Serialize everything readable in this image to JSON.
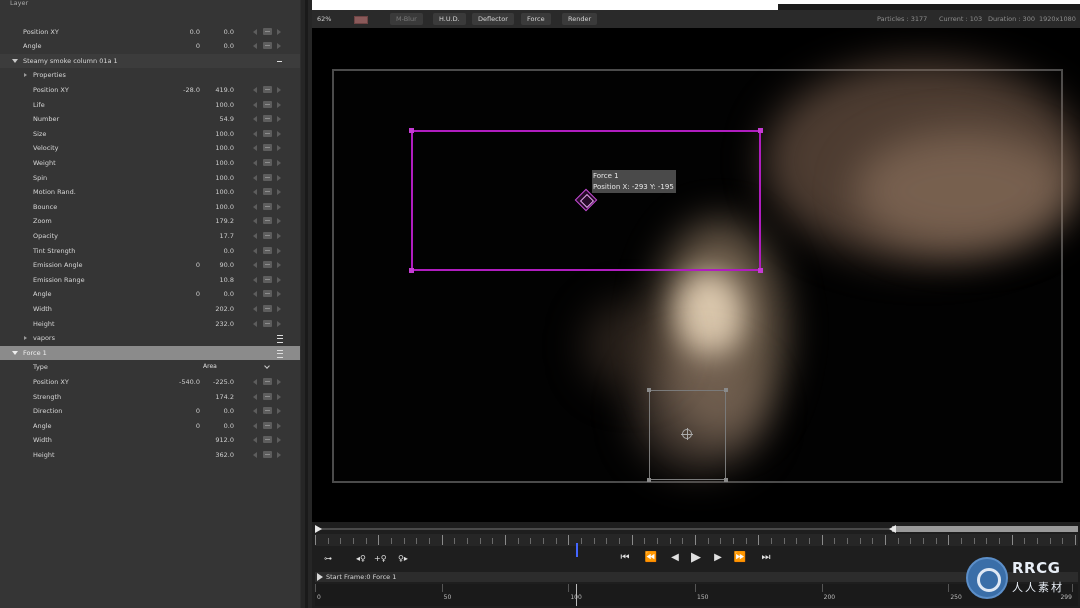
{
  "panel": {
    "top_partial": "Layer",
    "layer_rows": [
      {
        "label": "Position XY",
        "v1": "0.0",
        "v2": "0.0"
      },
      {
        "label": "Angle",
        "v1": "0",
        "v2": "0.0"
      }
    ],
    "emitter": {
      "name": "Steamy smoke column 01a 1",
      "properties_label": "Properties",
      "rows": [
        {
          "label": "Position XY",
          "v1": "-28.0",
          "v2": "419.0"
        },
        {
          "label": "Life",
          "v1": "",
          "v2": "100.0"
        },
        {
          "label": "Number",
          "v1": "",
          "v2": "54.9"
        },
        {
          "label": "Size",
          "v1": "",
          "v2": "100.0"
        },
        {
          "label": "Velocity",
          "v1": "",
          "v2": "100.0"
        },
        {
          "label": "Weight",
          "v1": "",
          "v2": "100.0"
        },
        {
          "label": "Spin",
          "v1": "",
          "v2": "100.0"
        },
        {
          "label": "Motion Rand.",
          "v1": "",
          "v2": "100.0"
        },
        {
          "label": "Bounce",
          "v1": "",
          "v2": "100.0"
        },
        {
          "label": "Zoom",
          "v1": "",
          "v2": "179.2"
        },
        {
          "label": "Opacity",
          "v1": "",
          "v2": "17.7"
        },
        {
          "label": "Tint Strength",
          "v1": "",
          "v2": "0.0"
        },
        {
          "label": "Emission Angle",
          "v1": "0",
          "v2": "90.0"
        },
        {
          "label": "Emission Range",
          "v1": "",
          "v2": "10.8"
        },
        {
          "label": "Angle",
          "v1": "0",
          "v2": "0.0"
        },
        {
          "label": "Width",
          "v1": "",
          "v2": "202.0"
        },
        {
          "label": "Height",
          "v1": "",
          "v2": "232.0"
        }
      ],
      "vapors_label": "vapors"
    },
    "force": {
      "name": "Force 1",
      "type_label": "Type",
      "type_value": "Area",
      "rows": [
        {
          "label": "Position XY",
          "v1": "-540.0",
          "v2": "-225.0"
        },
        {
          "label": "Strength",
          "v1": "",
          "v2": "174.2"
        },
        {
          "label": "Direction",
          "v1": "0",
          "v2": "0.0"
        },
        {
          "label": "Angle",
          "v1": "0",
          "v2": "0.0"
        },
        {
          "label": "Width",
          "v1": "",
          "v2": "912.0"
        },
        {
          "label": "Height",
          "v1": "",
          "v2": "362.0"
        }
      ]
    }
  },
  "toolbar": {
    "zoom": "62%",
    "mblur": "M-Blur",
    "hud": "H.U.D.",
    "deflector": "Deflector",
    "force": "Force",
    "render": "Render",
    "particles": "Particles : 3177",
    "current": "Current : 103",
    "duration": "Duration : 300",
    "resolution": "1920x1080"
  },
  "viewport": {
    "tooltip_line1": "Force 1",
    "tooltip_line2": "Position X: -293 Y: -195"
  },
  "timeline": {
    "track_label": "Start Frame:0 Force 1",
    "ruler_labels": [
      "0",
      "50",
      "100",
      "150",
      "200",
      "250",
      "299"
    ]
  },
  "watermark": {
    "line1": "RRCG",
    "line2": "人人素材"
  },
  "colors": {
    "force_gizmo": "#b01dbf",
    "panel_bg": "#353535",
    "selected_row": "#8b8b8b",
    "playhead": "#4466ff"
  }
}
